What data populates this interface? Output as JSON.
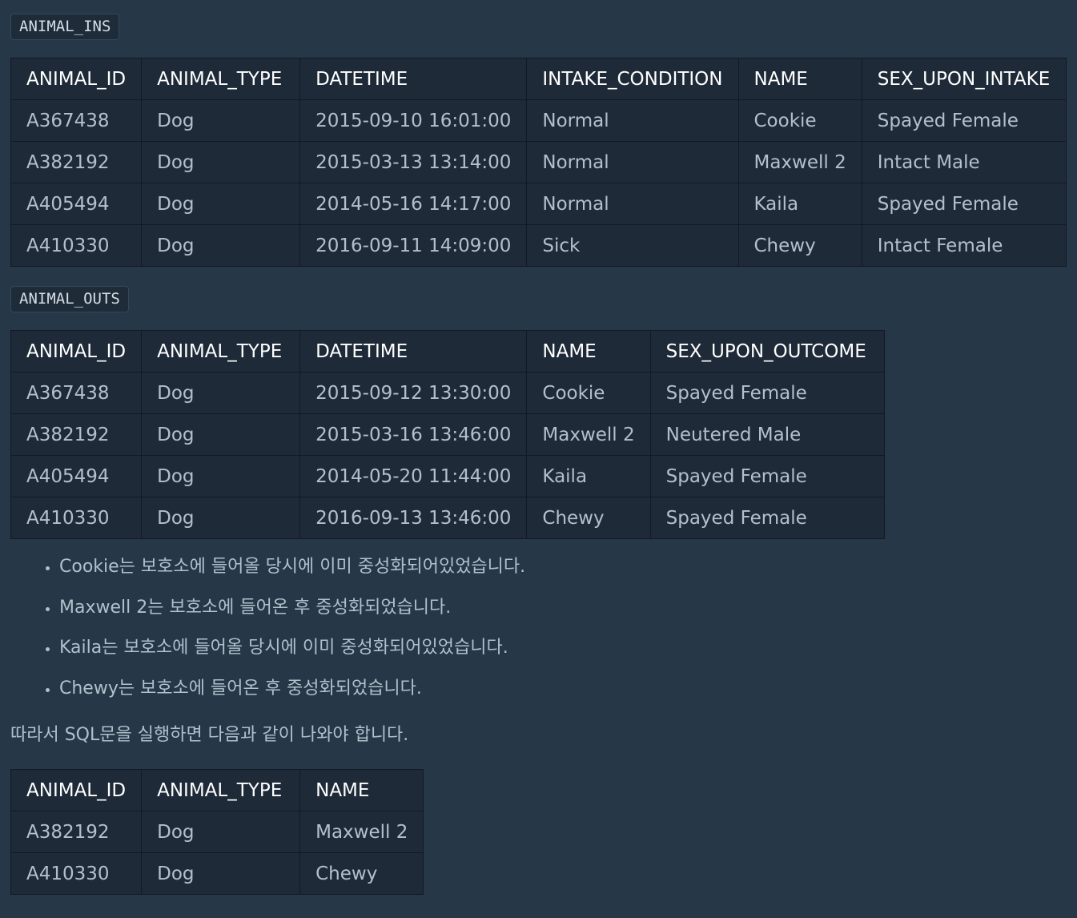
{
  "ins": {
    "label": "ANIMAL_INS",
    "headers": [
      "ANIMAL_ID",
      "ANIMAL_TYPE",
      "DATETIME",
      "INTAKE_CONDITION",
      "NAME",
      "SEX_UPON_INTAKE"
    ],
    "rows": [
      [
        "A367438",
        "Dog",
        "2015-09-10 16:01:00",
        "Normal",
        "Cookie",
        "Spayed Female"
      ],
      [
        "A382192",
        "Dog",
        "2015-03-13 13:14:00",
        "Normal",
        "Maxwell 2",
        "Intact Male"
      ],
      [
        "A405494",
        "Dog",
        "2014-05-16 14:17:00",
        "Normal",
        "Kaila",
        "Spayed Female"
      ],
      [
        "A410330",
        "Dog",
        "2016-09-11 14:09:00",
        "Sick",
        "Chewy",
        "Intact Female"
      ]
    ]
  },
  "outs": {
    "label": "ANIMAL_OUTS",
    "headers": [
      "ANIMAL_ID",
      "ANIMAL_TYPE",
      "DATETIME",
      "NAME",
      "SEX_UPON_OUTCOME"
    ],
    "rows": [
      [
        "A367438",
        "Dog",
        "2015-09-12 13:30:00",
        "Cookie",
        "Spayed Female"
      ],
      [
        "A382192",
        "Dog",
        "2015-03-16 13:46:00",
        "Maxwell 2",
        "Neutered Male"
      ],
      [
        "A405494",
        "Dog",
        "2014-05-20 11:44:00",
        "Kaila",
        "Spayed Female"
      ],
      [
        "A410330",
        "Dog",
        "2016-09-13 13:46:00",
        "Chewy",
        "Spayed Female"
      ]
    ]
  },
  "notes": [
    "Cookie는 보호소에 들어올 당시에 이미 중성화되어있었습니다.",
    "Maxwell 2는 보호소에 들어온 후 중성화되었습니다.",
    "Kaila는 보호소에 들어올 당시에 이미 중성화되어있었습니다.",
    "Chewy는 보호소에 들어온 후 중성화되었습니다."
  ],
  "conclusion": "따라서 SQL문을 실행하면 다음과 같이 나와야 합니다.",
  "result": {
    "headers": [
      "ANIMAL_ID",
      "ANIMAL_TYPE",
      "NAME"
    ],
    "rows": [
      [
        "A382192",
        "Dog",
        "Maxwell 2"
      ],
      [
        "A410330",
        "Dog",
        "Chewy"
      ]
    ]
  }
}
